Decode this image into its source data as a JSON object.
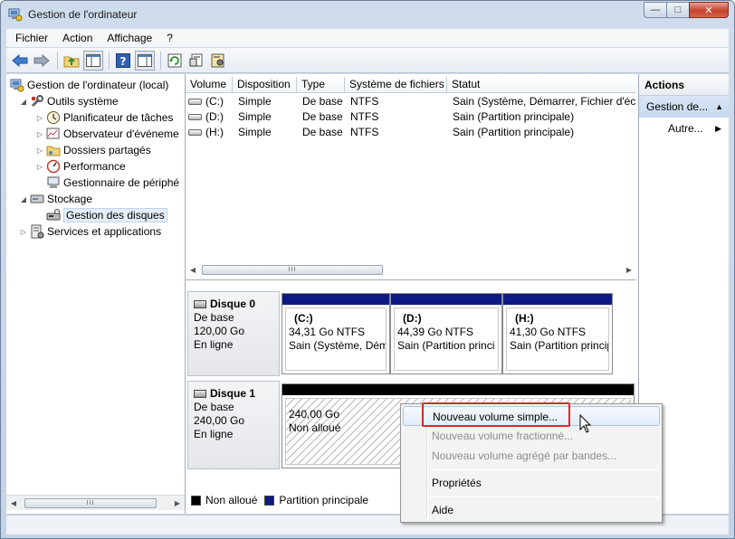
{
  "window": {
    "title": "Gestion de l'ordinateur",
    "minimize_glyph": "—",
    "maximize_glyph": "□",
    "close_glyph": "✕"
  },
  "menu": [
    "Fichier",
    "Action",
    "Affichage",
    "?"
  ],
  "toolbar_icons": [
    "back-arrow-icon",
    "forward-arrow-icon",
    "up-folder-icon",
    "show-hide-tree-icon",
    "help-icon",
    "show-hide-action-pane-icon",
    "refresh-icon",
    "properties-icon",
    "settings-icon"
  ],
  "tree": {
    "root": "Gestion de l'ordinateur (local)",
    "system_tools": "Outils système",
    "task_scheduler": "Planificateur de tâches",
    "event_viewer": "Observateur d'événeme",
    "shared_folders": "Dossiers partagés",
    "performance": "Performance",
    "device_manager": "Gestionnaire de périphé",
    "storage": "Stockage",
    "disk_management": "Gestion des disques",
    "services": "Services et applications",
    "expanded_glyph": "◢",
    "collapsed_glyph": "▷",
    "scroll_thumb": "III"
  },
  "volumes": {
    "headers": [
      "Volume",
      "Disposition",
      "Type",
      "Système de fichiers",
      "Statut"
    ],
    "rows": [
      {
        "volume": "(C:)",
        "layout": "Simple",
        "type": "De base",
        "fs": "NTFS",
        "status": "Sain (Système, Démarrer, Fichier d'éch"
      },
      {
        "volume": "(D:)",
        "layout": "Simple",
        "type": "De base",
        "fs": "NTFS",
        "status": "Sain (Partition principale)"
      },
      {
        "volume": "(H:)",
        "layout": "Simple",
        "type": "De base",
        "fs": "NTFS",
        "status": "Sain (Partition principale)"
      }
    ],
    "scroll_thumb": "III",
    "scroll_left": "◀",
    "scroll_right": "▶"
  },
  "disks": [
    {
      "name": "Disque 0",
      "kind": "De base",
      "size": "120,00 Go",
      "state": "En ligne",
      "partitions": [
        {
          "label": "(C:)",
          "size": "34,31 Go NTFS",
          "status": "Sain (Système, Dém"
        },
        {
          "label": "(D:)",
          "size": "44,39 Go NTFS",
          "status": "Sain (Partition princi"
        },
        {
          "label": "(H:)",
          "size": "41,30 Go NTFS",
          "status": "Sain (Partition princip"
        }
      ]
    },
    {
      "name": "Disque 1",
      "kind": "De base",
      "size": "240,00 Go",
      "state": "En ligne",
      "partitions": [
        {
          "size": "240,00 Go",
          "status": "Non alloué"
        }
      ]
    }
  ],
  "legend": {
    "unallocated": "Non alloué",
    "primary": "Partition principale",
    "unallocated_color": "#000000",
    "primary_color": "#0d1a84"
  },
  "actions": {
    "header": "Actions",
    "section": "Gestion de...",
    "more": "Autre...",
    "collapse_glyph": "▲",
    "submenu_glyph": "▶"
  },
  "context_menu": {
    "items": [
      {
        "label": "Nouveau volume simple...",
        "enabled": true
      },
      {
        "label": "Nouveau volume fractionné...",
        "enabled": false
      },
      {
        "label": "Nouveau volume agrégé par bandes...",
        "enabled": false
      },
      {
        "label": "Propriétés",
        "enabled": true
      },
      {
        "label": "Aide",
        "enabled": true
      }
    ]
  },
  "colors": {
    "primary_partition": "#0d1a84",
    "highlight_box": "#e0262a"
  }
}
